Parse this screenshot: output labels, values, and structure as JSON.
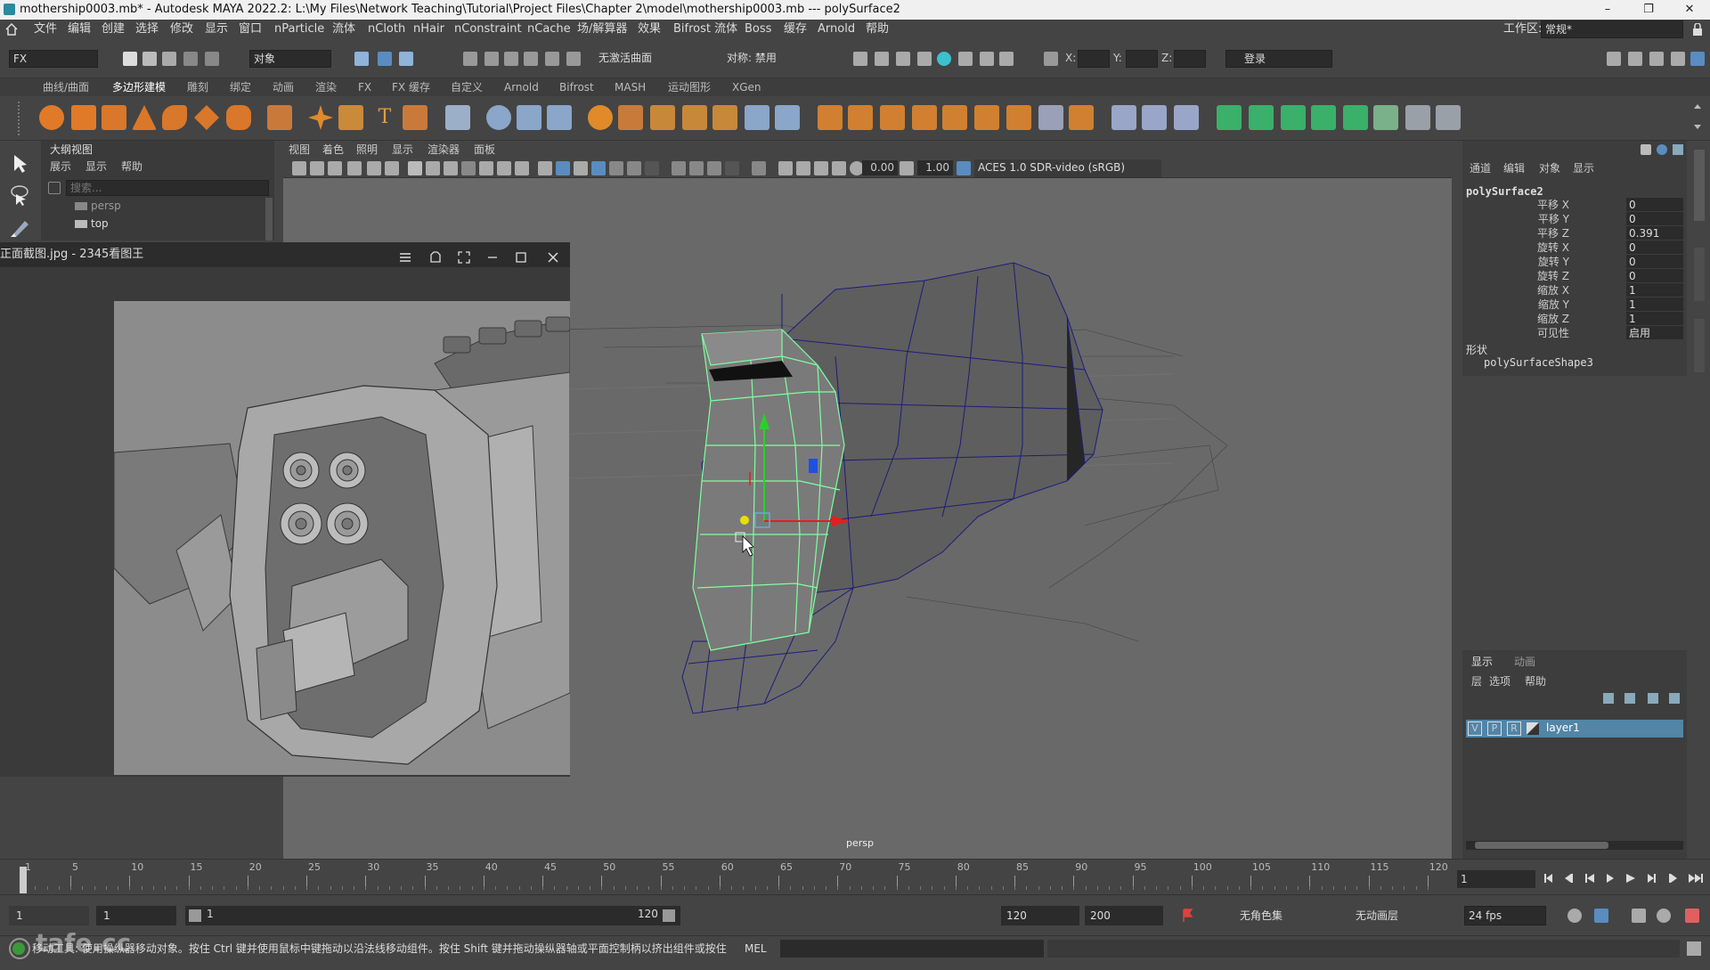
{
  "titlebar": {
    "title": "mothership0003.mb* - Autodesk MAYA 2022.2: L:\\My Files\\Network Teaching\\Tutorial\\Project Files\\Chapter 2\\model\\mothership0003.mb   ---   polySurface2",
    "minimize": "–",
    "restore": "❐",
    "close": "✕"
  },
  "menubar": {
    "items": [
      "文件",
      "编辑",
      "创建",
      "选择",
      "修改",
      "显示",
      "窗口",
      "nParticle",
      "流体",
      "nCloth",
      "nHair",
      "nConstraint",
      "nCache",
      "场/解算器",
      "效果",
      "Bifrost 流体",
      "Boss",
      "缓存",
      "Arnold",
      "帮助"
    ],
    "workspace_label": "工作区:",
    "workspace_value": "常规*"
  },
  "statusline": {
    "mode": "FX",
    "object_filter": "对象",
    "live_surface": "无激活曲面",
    "symmetry": "对称: 禁用",
    "x_label": "X:",
    "y_label": "Y:",
    "z_label": "Z:",
    "login": "登录"
  },
  "shelf": {
    "tabs": [
      "曲线/曲面",
      "多边形建模",
      "雕刻",
      "绑定",
      "动画",
      "渲染",
      "FX",
      "FX 缓存",
      "自定义",
      "Arnold",
      "Bifrost",
      "MASH",
      "运动图形",
      "XGen"
    ]
  },
  "outliner": {
    "title": "大纲视图",
    "menus": [
      "展示",
      "显示",
      "帮助"
    ],
    "search_placeholder": "搜索...",
    "items": [
      "persp",
      "top"
    ]
  },
  "image_viewer": {
    "title": "正面截图.jpg - 2345看图王"
  },
  "viewport": {
    "menus": [
      "视图",
      "着色",
      "照明",
      "显示",
      "渲染器",
      "面板"
    ],
    "value_a": "0.00",
    "value_b": "1.00",
    "color_space": "ACES 1.0 SDR-video (sRGB)",
    "camera_label": "persp"
  },
  "channelbox": {
    "menus": [
      "通道",
      "编辑",
      "对象",
      "显示"
    ],
    "object_name": "polySurface2",
    "channels": [
      {
        "label": "平移 X",
        "value": "0"
      },
      {
        "label": "平移 Y",
        "value": "0"
      },
      {
        "label": "平移 Z",
        "value": "0.391"
      },
      {
        "label": "旋转 X",
        "value": "0"
      },
      {
        "label": "旋转 Y",
        "value": "0"
      },
      {
        "label": "旋转 Z",
        "value": "0"
      },
      {
        "label": "缩放 X",
        "value": "1"
      },
      {
        "label": "缩放 Y",
        "value": "1"
      },
      {
        "label": "缩放 Z",
        "value": "1"
      },
      {
        "label": "可见性",
        "value": "启用"
      }
    ],
    "shapes_label": "形状",
    "shape_name": "polySurfaceShape3"
  },
  "layers": {
    "tabs": [
      "显示",
      "动画"
    ],
    "menus": [
      "层",
      "选项",
      "帮助"
    ],
    "layer": {
      "v": "V",
      "p": "P",
      "r": "R",
      "name": "layer1"
    }
  },
  "timeslider": {
    "ticks": [
      "1",
      "5",
      "10",
      "15",
      "20",
      "25",
      "30",
      "35",
      "40",
      "45",
      "50",
      "55",
      "60",
      "65",
      "70",
      "75",
      "80",
      "85",
      "90",
      "95",
      "100",
      "105",
      "110",
      "115",
      "120"
    ],
    "current_frame": "1"
  },
  "rangebar": {
    "start": "1",
    "anim_start": "1",
    "range_start": "1",
    "range_end": "120",
    "end": "120",
    "anim_end": "200",
    "charset": "无角色集",
    "anim_layer": "无动画层",
    "fps": "24 fps"
  },
  "helpline": {
    "text": "移动工具: 使用操纵器移动对象。按住 Ctrl 键并使用鼠标中键拖动以沿法线移动组件。按住 Shift 键并拖动操纵器轴或平面控制柄以挤出组件或按住 C",
    "mel": "MEL",
    "watermark": "tafe.cc"
  },
  "colors": {
    "accent": "#5a8cbf",
    "selected_wire": "#7fffa0",
    "wire": "#1c1c7c"
  }
}
